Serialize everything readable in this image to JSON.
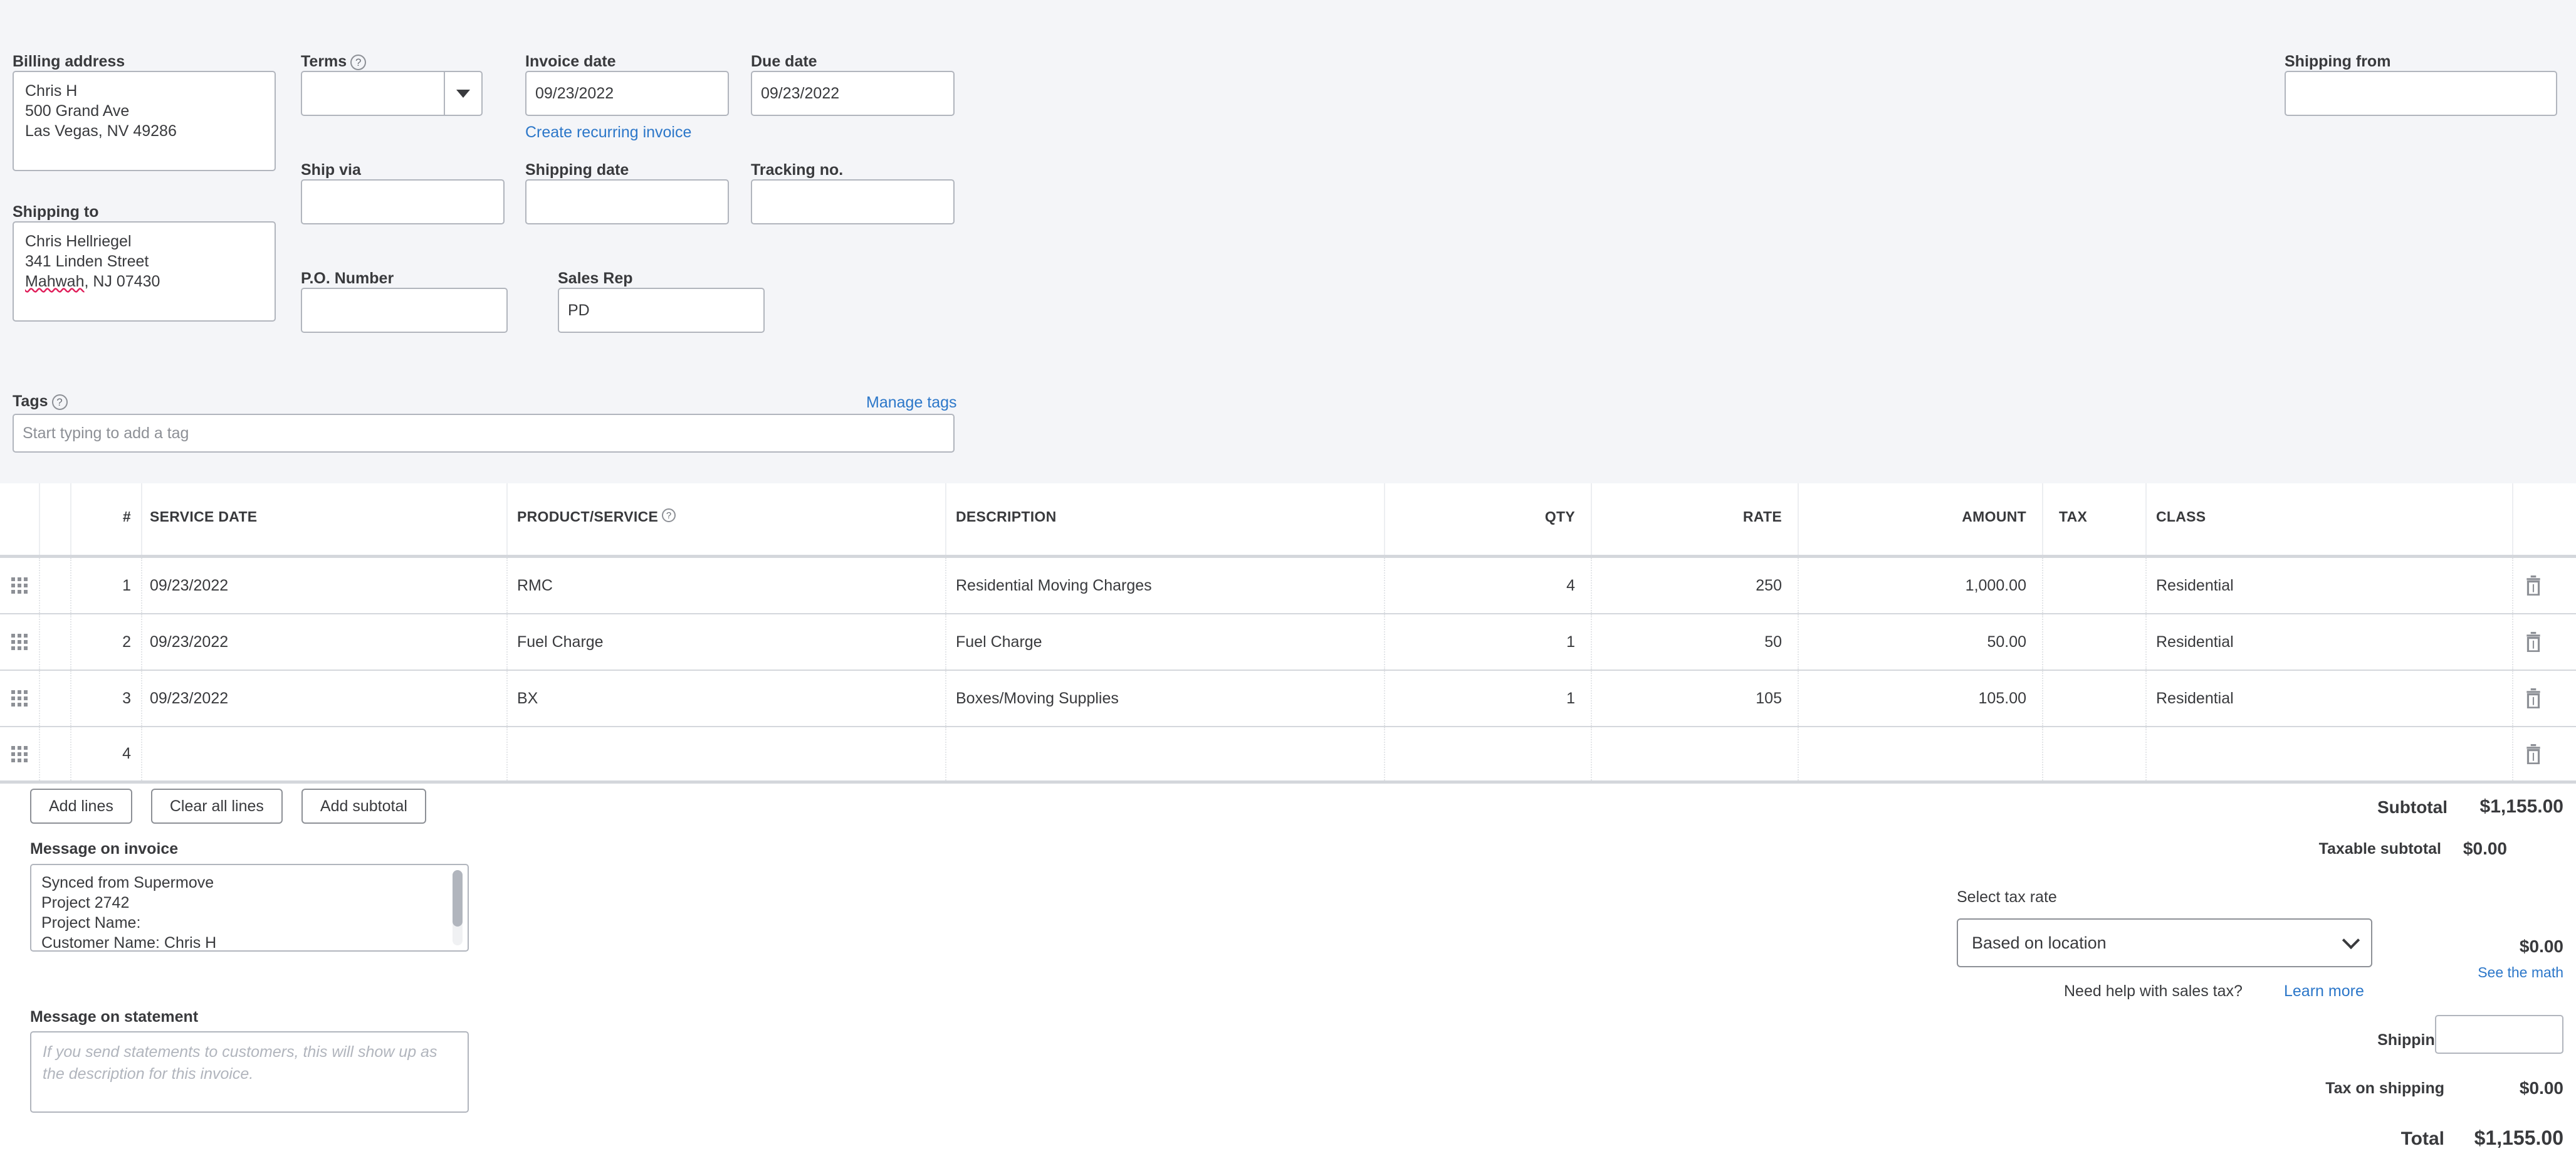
{
  "form": {
    "billing_address_label": "Billing address",
    "billing_address_value": "Chris H\n500 Grand Ave\nLas Vegas, NV 49286",
    "shipping_to_label": "Shipping to",
    "shipping_to_line1": "Chris Hellriegel",
    "shipping_to_line2": "341 Linden Street",
    "shipping_to_city": "Mahwah",
    "shipping_to_rest": ",  NJ  07430",
    "terms_label": "Terms",
    "terms_value": "",
    "ship_via_label": "Ship via",
    "ship_via_value": "",
    "po_number_label": "P.O. Number",
    "po_number_value": "",
    "invoice_date_label": "Invoice date",
    "invoice_date_value": "09/23/2022",
    "create_recurring_link": "Create recurring invoice",
    "shipping_date_label": "Shipping date",
    "shipping_date_value": "",
    "sales_rep_label": "Sales Rep",
    "sales_rep_value": "PD",
    "due_date_label": "Due date",
    "due_date_value": "09/23/2022",
    "tracking_no_label": "Tracking no.",
    "tracking_no_value": "",
    "shipping_from_label": "Shipping from",
    "shipping_from_value": "",
    "tags_label": "Tags",
    "manage_tags_link": "Manage tags",
    "tags_placeholder": "Start typing to add a tag"
  },
  "line_table": {
    "columns": {
      "num": "#",
      "service_date": "SERVICE DATE",
      "product_service": "PRODUCT/SERVICE",
      "description": "DESCRIPTION",
      "qty": "QTY",
      "rate": "RATE",
      "amount": "AMOUNT",
      "tax": "TAX",
      "class": "CLASS"
    },
    "rows": [
      {
        "num": "1",
        "service_date": "09/23/2022",
        "product_service": "RMC",
        "description": "Residential Moving Charges",
        "qty": "4",
        "rate": "250",
        "amount": "1,000.00",
        "tax": "",
        "class": "Residential"
      },
      {
        "num": "2",
        "service_date": "09/23/2022",
        "product_service": "Fuel Charge",
        "description": "Fuel Charge",
        "qty": "1",
        "rate": "50",
        "amount": "50.00",
        "tax": "",
        "class": "Residential"
      },
      {
        "num": "3",
        "service_date": "09/23/2022",
        "product_service": "BX",
        "description": "Boxes/Moving Supplies",
        "qty": "1",
        "rate": "105",
        "amount": "105.00",
        "tax": "",
        "class": "Residential"
      },
      {
        "num": "4",
        "service_date": "",
        "product_service": "",
        "description": "",
        "qty": "",
        "rate": "",
        "amount": "",
        "tax": "",
        "class": ""
      }
    ]
  },
  "actions": {
    "add_lines": "Add lines",
    "clear_all_lines": "Clear all lines",
    "add_subtotal": "Add subtotal"
  },
  "messages": {
    "message_on_invoice_label": "Message on invoice",
    "message_on_invoice_value": "Synced from Supermove\nProject 2742\nProject Name:\nCustomer Name: Chris H\nSalesperson Name: Peter D",
    "message_on_statement_label": "Message on statement",
    "message_on_statement_placeholder": "If you send statements to customers, this will show up as the description for this invoice."
  },
  "totals": {
    "subtotal_label": "Subtotal",
    "subtotal_value": "$1,155.00",
    "taxable_subtotal_label": "Taxable subtotal",
    "taxable_subtotal_value": "$0.00",
    "select_tax_rate_label": "Select tax rate",
    "tax_rate_selected": "Based on location",
    "tax_amount_value": "$0.00",
    "see_the_math_link": "See the math",
    "sales_tax_help_text": "Need help with sales tax?",
    "learn_more_link": "Learn more",
    "shipping_label": "Shipping",
    "shipping_value": "",
    "tax_on_shipping_label": "Tax on shipping",
    "tax_on_shipping_value": "$0.00",
    "total_label": "Total",
    "total_value": "$1,155.00"
  },
  "colors": {
    "link": "#2c77c9",
    "background": "#f4f5f8",
    "border": "#b1b5bd",
    "text": "#393a3d",
    "spellcheck": "#e01e5a"
  },
  "icons": {
    "help": "?",
    "drag_handle": "drag-handle-icon",
    "trash": "trash-icon",
    "caret_down": "caret-down-icon",
    "chevron_down": "chevron-down-icon"
  }
}
